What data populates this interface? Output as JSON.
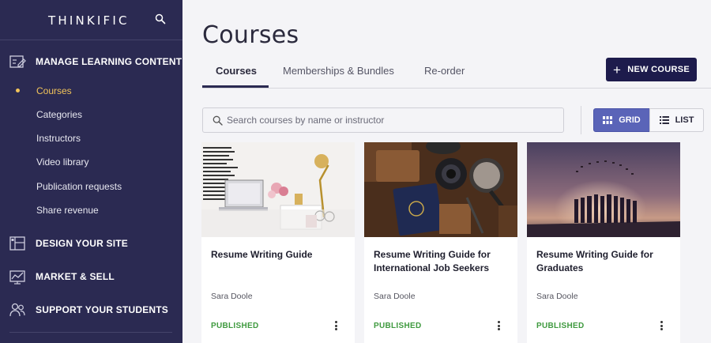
{
  "sidebar": {
    "brand": "THINKIFIC",
    "sections": [
      {
        "label": "MANAGE LEARNING CONTENT",
        "icon": "edit-list-icon"
      },
      {
        "label": "DESIGN YOUR SITE",
        "icon": "layout-icon"
      },
      {
        "label": "MARKET & SELL",
        "icon": "chart-icon"
      },
      {
        "label": "SUPPORT YOUR STUDENTS",
        "icon": "users-icon"
      }
    ],
    "sub_items": [
      {
        "label": "Courses",
        "active": true
      },
      {
        "label": "Categories"
      },
      {
        "label": "Instructors"
      },
      {
        "label": "Video library"
      },
      {
        "label": "Publication requests"
      },
      {
        "label": "Share revenue"
      }
    ],
    "accent_color": "#f2c45a"
  },
  "main": {
    "title": "Courses",
    "tabs": [
      {
        "label": "Courses",
        "active": true
      },
      {
        "label": "Memberships & Bundles"
      },
      {
        "label": "Re-order"
      }
    ],
    "new_button": "NEW COURSE",
    "search_placeholder": "Search courses by name or instructor",
    "view_toggle": {
      "grid": "GRID",
      "list": "LIST",
      "selected": "GRID"
    }
  },
  "courses": [
    {
      "title": "Resume Writing Guide",
      "author": "Sara Doole",
      "status": "PUBLISHED"
    },
    {
      "title": "Resume Writing Guide for International Job Seekers",
      "author": "Sara Doole",
      "status": "PUBLISHED"
    },
    {
      "title": "Resume Writing Guide for Graduates",
      "author": "Sara Doole",
      "status": "PUBLISHED"
    }
  ],
  "colors": {
    "sidebar_bg": "#2b2a52",
    "primary_button": "#1d1b4c",
    "grid_active": "#5a64b8",
    "published": "#3f9a3f"
  }
}
